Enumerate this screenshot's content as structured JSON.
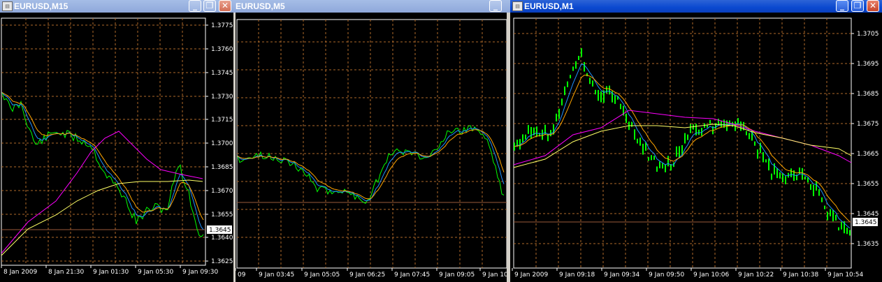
{
  "windows": [
    {
      "title": "EURUSD,M15",
      "price_axis": [
        "1.3775",
        "1.3760",
        "1.3745",
        "1.3730",
        "1.3715",
        "1.3700",
        "1.3685",
        "1.3670",
        "1.3655",
        "1.3640",
        "1.3625"
      ],
      "current_price": "1.3645",
      "time_axis": [
        "8 Jan 2009",
        "8 Jan 21:30",
        "9 Jan 01:30",
        "9 Jan 05:30",
        "9 Jan 09:30"
      ]
    },
    {
      "title": "EURUSD,M5",
      "time_axis": [
        "09",
        "9 Jan 03:45",
        "9 Jan 05:05",
        "9 Jan 06:25",
        "9 Jan 07:45",
        "9 Jan 09:05",
        "9 Jan 10:"
      ]
    },
    {
      "title": "EURUSD,M1",
      "price_axis": [
        "1.3705",
        "1.3695",
        "1.3685",
        "1.3675",
        "1.3665",
        "1.3655",
        "1.3645",
        "1.3635"
      ],
      "current_price": "1.3645",
      "time_axis": [
        "9 Jan 2009",
        "9 Jan 09:18",
        "9 Jan 09:34",
        "9 Jan 09:50",
        "9 Jan 10:06",
        "9 Jan 10:22",
        "9 Jan 10:38",
        "9 Jan 10:54"
      ]
    }
  ],
  "colors": {
    "background": "#000000",
    "grid": "#b06a2a",
    "price": "#00ff00",
    "ma_fast": "#1e90ff",
    "ma_mid": "#ffa500",
    "ma_slow": "#ff00ff",
    "ma_long": "#ffff66",
    "price_line": "#9a5a3a"
  },
  "icons": [
    "chart-icon",
    "minimize-icon",
    "restore-icon",
    "close-icon"
  ]
}
